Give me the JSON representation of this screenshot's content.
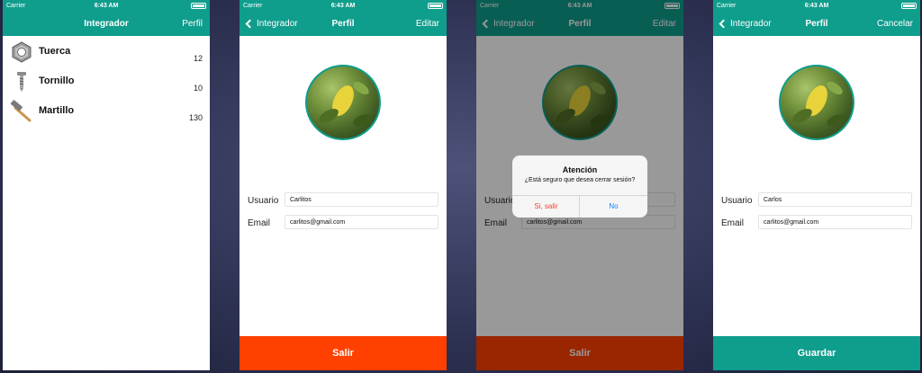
{
  "colors": {
    "teal": "#0f9d8c",
    "logout": "#ff4000",
    "link_blue": "#157efb",
    "destructive": "#ff3b30"
  },
  "status": {
    "carrier": "Carrier",
    "time": "6:43 AM"
  },
  "screen1": {
    "title": "Integrador",
    "right_button": "Perfil",
    "items": [
      {
        "name": "Tuerca",
        "qty": "12",
        "icon": "nut-icon"
      },
      {
        "name": "Tornillo",
        "qty": "10",
        "icon": "screw-icon"
      },
      {
        "name": "Martillo",
        "qty": "130",
        "icon": "hammer-icon"
      }
    ]
  },
  "screen2": {
    "back": "Integrador",
    "title": "Perfil",
    "right_button": "Editar",
    "usuario_label": "Usuario",
    "usuario_value": "Carlitos",
    "email_label": "Email",
    "email_value": "carlitos@gmail.com",
    "bottom_button": "Salir"
  },
  "screen3": {
    "back": "Integrador",
    "title": "Perfil",
    "right_button": "Editar",
    "usuario_label": "Usuario",
    "email_label": "Email",
    "email_value": "carlitos@gmail.com",
    "bottom_button": "Salir",
    "alert": {
      "title": "Atención",
      "message": "¿Está seguro que desea cerrar sesión?",
      "confirm": "Si, salir",
      "cancel": "No"
    }
  },
  "screen4": {
    "back": "Integrador",
    "title": "Perfil",
    "right_button": "Cancelar",
    "usuario_label": "Usuario",
    "usuario_value": "Carlos",
    "email_label": "Email",
    "email_value": "carlitos@gmail.com",
    "bottom_button": "Guardar"
  }
}
